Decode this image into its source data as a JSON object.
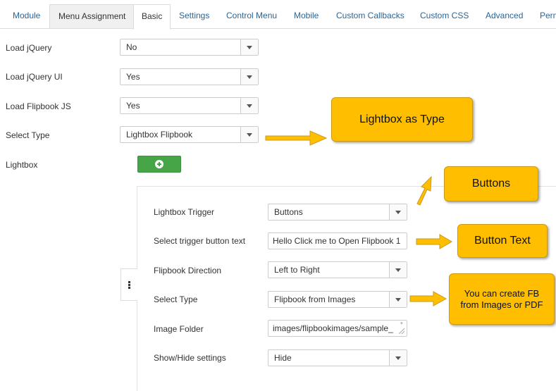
{
  "tabs": [
    {
      "label": "Module"
    },
    {
      "label": "Menu Assignment"
    },
    {
      "label": "Basic"
    },
    {
      "label": "Settings"
    },
    {
      "label": "Control Menu"
    },
    {
      "label": "Mobile"
    },
    {
      "label": "Custom Callbacks"
    },
    {
      "label": "Custom CSS"
    },
    {
      "label": "Advanced"
    },
    {
      "label": "Perm"
    }
  ],
  "basic": {
    "load_jquery": {
      "label": "Load jQuery",
      "value": "No"
    },
    "load_jquery_ui": {
      "label": "Load jQuery UI",
      "value": "Yes"
    },
    "load_flipbook_js": {
      "label": "Load Flipbook JS",
      "value": "Yes"
    },
    "select_type": {
      "label": "Select Type",
      "value": "Lightbox Flipbook"
    },
    "lightbox": {
      "label": "Lightbox"
    }
  },
  "lightbox_form": {
    "trigger": {
      "label": "Lightbox Trigger",
      "value": "Buttons"
    },
    "button_text": {
      "label": "Select trigger button text",
      "value": "Hello Click me to Open Flipbook 1"
    },
    "direction": {
      "label": "Flipbook Direction",
      "value": "Left to Right"
    },
    "select_type": {
      "label": "Select Type",
      "value": "Flipbook from Images"
    },
    "image_folder": {
      "label": "Image Folder",
      "value": "images/flipbookimages/sample_"
    },
    "show_hide": {
      "label": "Show/Hide settings",
      "value": "Hide"
    }
  },
  "callouts": {
    "lightbox_type": "Lightbox as Type",
    "buttons": "Buttons",
    "button_text": "Button Text",
    "create_fb": "You can create FB from Images or PDF"
  },
  "colors": {
    "callout_fill": "#ffbf00",
    "callout_border": "#c9991a",
    "add_button": "#46a546",
    "tab_link": "#2a6496"
  },
  "icons": {
    "add": "plus-circle-icon",
    "caret": "caret-down-icon",
    "drag": "drag-handle-icon"
  }
}
